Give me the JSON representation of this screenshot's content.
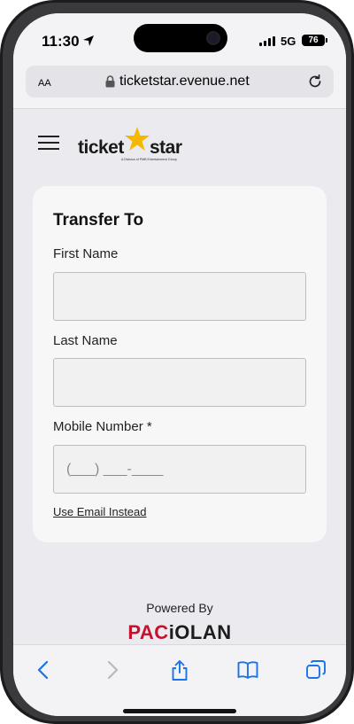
{
  "status_bar": {
    "time": "11:30",
    "network": "5G",
    "battery": "76"
  },
  "browser": {
    "text_size_label": "AA",
    "url": "ticketstar.evenue.net"
  },
  "header": {
    "logo_text": "ticketstar",
    "logo_tagline": "A Division of PMB Entertainment Group"
  },
  "form": {
    "title": "Transfer To",
    "first_name_label": "First Name",
    "first_name_value": "",
    "last_name_label": "Last Name",
    "last_name_value": "",
    "mobile_label": "Mobile Number *",
    "mobile_placeholder": "(___) ___-____",
    "alt_link": "Use Email Instead"
  },
  "footer": {
    "powered_by": "Powered By",
    "brand_red": "PAC",
    "brand_dark": "iOLAN"
  },
  "colors": {
    "accent": "#1a73e8",
    "brand_red": "#c4122f",
    "logo_star": "#f5b800"
  }
}
